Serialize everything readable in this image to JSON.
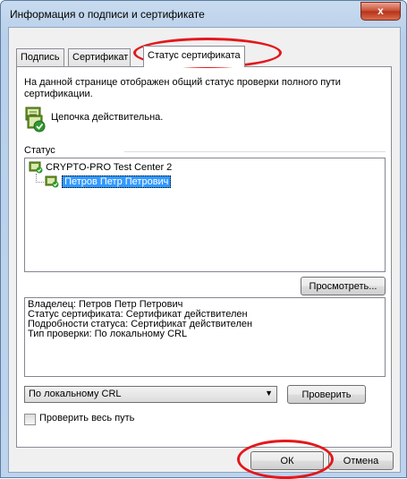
{
  "window": {
    "title": "Информация о подписи и сертификате",
    "close_glyph": "x"
  },
  "tabs": [
    {
      "label": "Подпись"
    },
    {
      "label": "Сертификат"
    },
    {
      "label": "Статус сертификата"
    }
  ],
  "status_tab": {
    "description": "На данной странице отображен общий статус проверки полного пути сертификации.",
    "chain_status": "Цепочка действительна.",
    "group_label": "Статус",
    "tree": [
      {
        "label": "CRYPTO-PRO Test Center 2",
        "selected": false
      },
      {
        "label": "Петров Петр Петрович",
        "selected": true
      }
    ],
    "view_button": "Просмотреть...",
    "info_lines": [
      "Владелец: Петров Петр Петрович",
      "Статус сертификата: Сертификат действителен",
      "Подробности статуса: Сертификат действителен",
      "Тип проверки: По локальному CRL"
    ],
    "check_mode": {
      "selected": "По локальному CRL"
    },
    "check_button": "Проверить",
    "full_path_checkbox": {
      "label": "Проверить весь путь",
      "checked": false
    }
  },
  "footer": {
    "ok": "ОК",
    "cancel": "Отмена"
  },
  "colors": {
    "highlight_ellipse": "#e3171c",
    "selection": "#3399ff",
    "ok_check": "#2f9a2f"
  },
  "icons": [
    "close-icon",
    "certificate-chain-valid-icon",
    "certificate-valid-icon",
    "dropdown-arrow-icon",
    "checkbox-icon"
  ]
}
